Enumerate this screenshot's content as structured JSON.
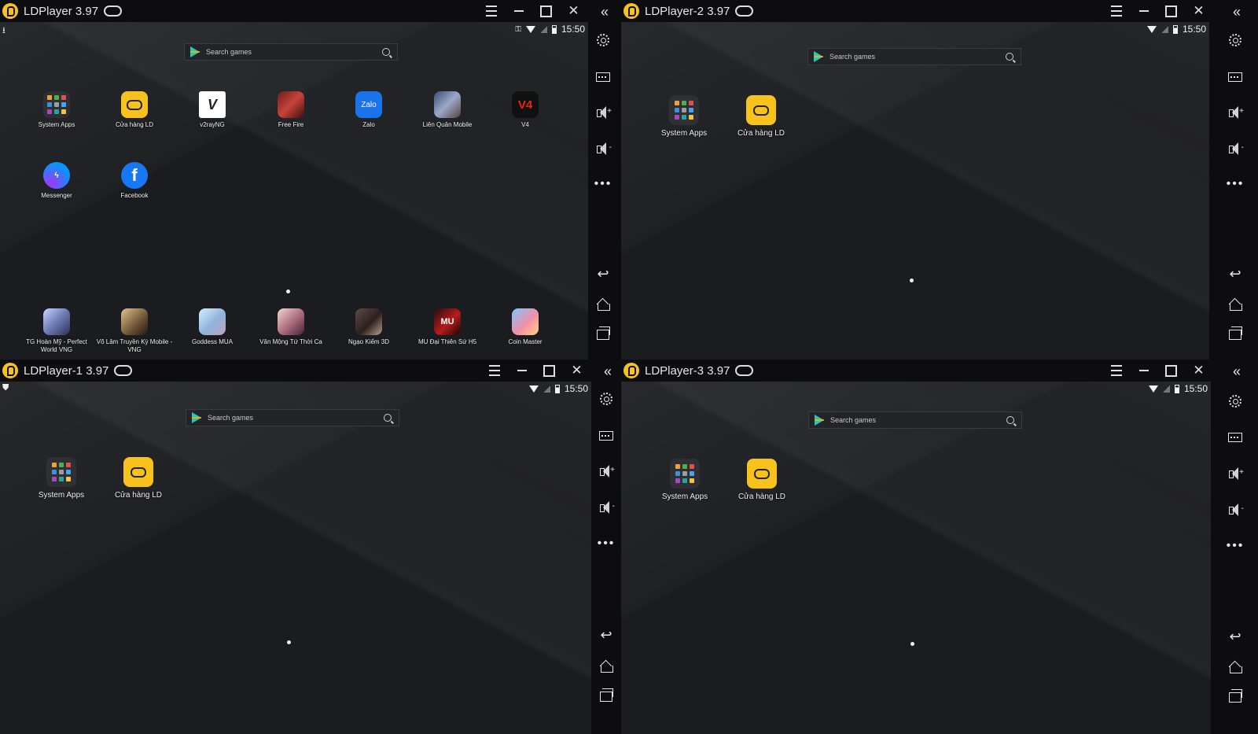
{
  "windows": [
    {
      "title": "LDPlayer 3.97",
      "time": "15:50",
      "search_placeholder": "Search games",
      "apps": [
        {
          "label": "System Apps",
          "icon": "system-apps-icon"
        },
        {
          "label": "Cửa hàng LD",
          "icon": "ld-store-icon"
        },
        {
          "label": "v2rayNG",
          "icon": "v2rayng-icon"
        },
        {
          "label": "Free Fire",
          "icon": "free-fire-icon"
        },
        {
          "label": "Zalo",
          "icon": "zalo-icon"
        },
        {
          "label": "Liên Quân Mobile",
          "icon": "lien-quan-icon"
        },
        {
          "label": "V4",
          "icon": "v4-icon"
        },
        {
          "label": "Messenger",
          "icon": "messenger-icon"
        },
        {
          "label": "Facebook",
          "icon": "facebook-icon"
        }
      ],
      "dock": [
        {
          "label": "TG Hoàn Mỹ - Perfect World VNG",
          "icon": "perfect-world-icon"
        },
        {
          "label": "Võ Lâm Truyền Kỳ Mobile - VNG",
          "icon": "vo-lam-icon"
        },
        {
          "label": "Goddess MUA",
          "icon": "goddess-mua-icon"
        },
        {
          "label": "Vân Mộng Tứ Thời Ca",
          "icon": "van-mong-icon"
        },
        {
          "label": "Ngạo Kiếm 3D",
          "icon": "ngao-kiem-icon"
        },
        {
          "label": "MU Đại Thiên Sứ H5",
          "icon": "mu-icon"
        },
        {
          "label": "Coin Master",
          "icon": "coin-master-icon"
        }
      ]
    },
    {
      "title": "LDPlayer-2 3.97",
      "time": "15:50",
      "search_placeholder": "Search games",
      "apps": [
        {
          "label": "System Apps",
          "icon": "system-apps-icon"
        },
        {
          "label": "Cửa hàng LD",
          "icon": "ld-store-icon"
        }
      ]
    },
    {
      "title": "LDPlayer-1 3.97",
      "time": "15:50",
      "search_placeholder": "Search games",
      "apps": [
        {
          "label": "System Apps",
          "icon": "system-apps-icon"
        },
        {
          "label": "Cửa hàng LD",
          "icon": "ld-store-icon"
        }
      ]
    },
    {
      "title": "LDPlayer-3 3.97",
      "time": "15:50",
      "search_placeholder": "Search games",
      "apps": [
        {
          "label": "System Apps",
          "icon": "system-apps-icon"
        },
        {
          "label": "Cửa hàng LD",
          "icon": "ld-store-icon"
        }
      ]
    }
  ],
  "icons": {
    "gamepad": "🎮",
    "collapse": "«",
    "back": "↩",
    "more": "•••",
    "download": "⭳",
    "key": "⚿",
    "shield": "⛊",
    "facebook": "f",
    "zalo": "Zalo",
    "v2rayng": "V",
    "v4": "V4",
    "mu": "MU"
  },
  "colors": {
    "ld_yellow": "#f7c21b",
    "titlebar": "#0d0d0f",
    "desktop": "#1b1c20"
  }
}
